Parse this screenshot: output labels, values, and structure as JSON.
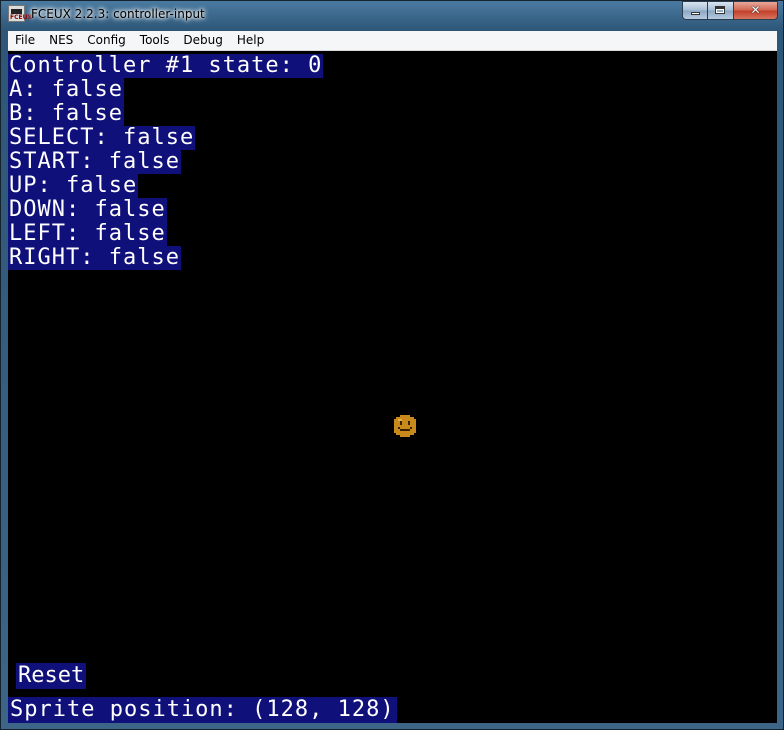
{
  "window": {
    "title": "FCEUX 2.2.3: controller-input",
    "app_icon_text": "FCEUX"
  },
  "menu": [
    "File",
    "NES",
    "Config",
    "Tools",
    "Debug",
    "Help"
  ],
  "controller": {
    "header": "Controller #1 state: 0",
    "buttons": [
      "A: false",
      "B: false",
      "SELECT: false",
      "START: false",
      "UP: false",
      "DOWN: false",
      "LEFT: false",
      "RIGHT: false"
    ]
  },
  "reset_label": "Reset",
  "sprite_position_text": "Sprite position: (128, 128)",
  "colors": {
    "text_bg": "#10107a",
    "text_fg": "#ffffff",
    "sprite": "#c88a1a"
  },
  "sprite_icon": "smiley-icon"
}
